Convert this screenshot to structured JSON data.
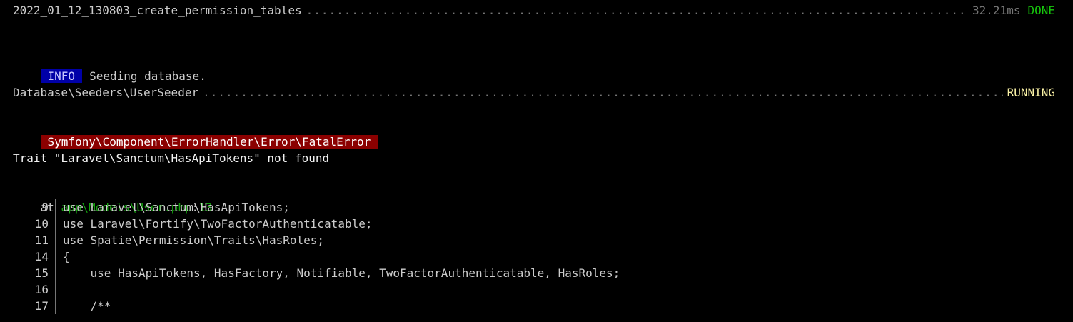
{
  "migration": {
    "name": "2022_01_12_130803_create_permission_tables",
    "timing": "32.21ms",
    "status": "DONE"
  },
  "info": {
    "badge": "INFO",
    "message": "Seeding database."
  },
  "seeder": {
    "name": "Database\\Seeders\\UserSeeder",
    "status": "RUNNING"
  },
  "error": {
    "class": "Symfony\\Component\\ErrorHandler\\Error\\FatalError",
    "message": "Trait \"Laravel\\Sanctum\\HasApiTokens\" not found"
  },
  "location": {
    "prefix": "at ",
    "file": "app\\Models\\User.php",
    "separator": ":",
    "line": "13"
  },
  "code_lines": [
    {
      "no": "9",
      "text": "use Laravel\\Sanctum\\HasApiTokens;"
    },
    {
      "no": "10",
      "text": "use Laravel\\Fortify\\TwoFactorAuthenticatable;"
    },
    {
      "no": "11",
      "text": "use Spatie\\Permission\\Traits\\HasRoles;"
    },
    {
      "no": "14",
      "text": "{"
    },
    {
      "no": "15",
      "text": "    use HasApiTokens, HasFactory, Notifiable, TwoFactorAuthenticatable, HasRoles;"
    },
    {
      "no": "16",
      "text": ""
    },
    {
      "no": "17",
      "text": "    /**"
    }
  ],
  "colors": {
    "background": "#000000",
    "done": "#16c60c",
    "running": "#f9f1a5",
    "info_badge": "#0000a8",
    "error_badge": "#8b0000",
    "path": "#13a10e"
  }
}
